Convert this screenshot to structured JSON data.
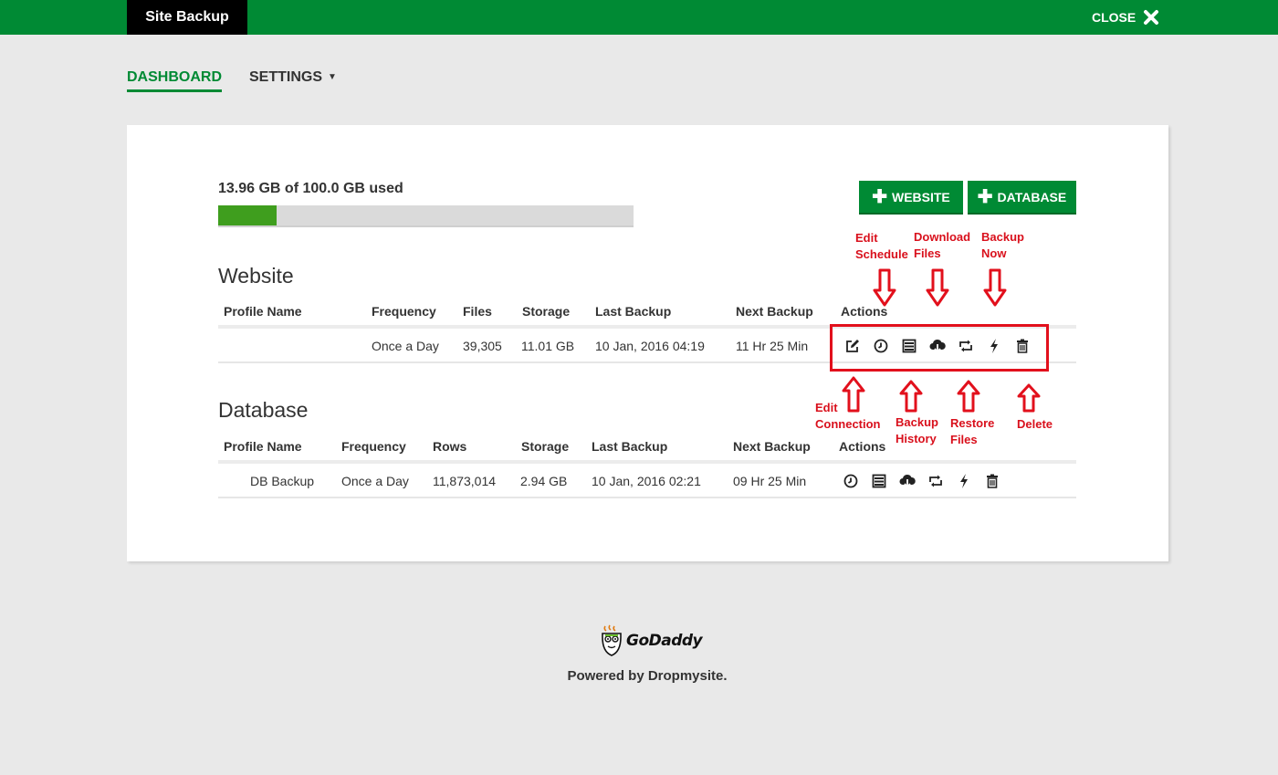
{
  "app": {
    "brand": "Site Backup",
    "close_label": "CLOSE"
  },
  "nav": {
    "dashboard": "DASHBOARD",
    "settings": "SETTINGS"
  },
  "usage": {
    "text": "13.96 GB of 100.0 GB used",
    "used_gb": 13.96,
    "total_gb": 100.0
  },
  "buttons": {
    "add_website": "WEBSITE",
    "add_database": "DATABASE"
  },
  "website": {
    "title": "Website",
    "headers": {
      "profile": "Profile Name",
      "frequency": "Frequency",
      "files": "Files",
      "storage": "Storage",
      "last_backup": "Last Backup",
      "next_backup": "Next Backup",
      "actions": "Actions"
    },
    "rows": [
      {
        "profile": "",
        "frequency": "Once a Day",
        "files": "39,305",
        "storage": "11.01 GB",
        "last_backup": "10 Jan, 2016 04:19",
        "next_backup": "11 Hr 25 Min",
        "actions": [
          "edit-icon",
          "clock-icon",
          "history-icon",
          "cloud-download-icon",
          "restore-icon",
          "bolt-icon",
          "trash-icon"
        ]
      }
    ]
  },
  "database": {
    "title": "Database",
    "headers": {
      "profile": "Profile Name",
      "frequency": "Frequency",
      "rows": "Rows",
      "storage": "Storage",
      "last_backup": "Last Backup",
      "next_backup": "Next Backup",
      "actions": "Actions"
    },
    "rows": [
      {
        "profile": "DB Backup",
        "frequency": "Once a Day",
        "rows": "11,873,014",
        "storage": "2.94 GB",
        "last_backup": "10 Jan, 2016 02:21",
        "next_backup": "09 Hr 25 Min",
        "actions": [
          "clock-icon",
          "history-icon",
          "cloud-download-icon",
          "restore-icon",
          "bolt-icon",
          "trash-icon"
        ]
      }
    ]
  },
  "annotations": {
    "edit_schedule": [
      "Edit",
      "Schedule"
    ],
    "download_files": [
      "Download",
      "Files"
    ],
    "backup_now": [
      "Backup",
      "Now"
    ],
    "edit_connection": [
      "Edit",
      "Connection"
    ],
    "backup_history": [
      "Backup",
      "History"
    ],
    "restore_files": [
      "Restore",
      "Files"
    ],
    "delete": [
      "Delete"
    ]
  },
  "footer": {
    "logo": "GoDaddy",
    "powered_by": "Powered by Dropmysite."
  },
  "colors": {
    "brand_green": "#008a34",
    "usage_fill": "#3f9e1e",
    "annotation_red": "#e2101c"
  }
}
